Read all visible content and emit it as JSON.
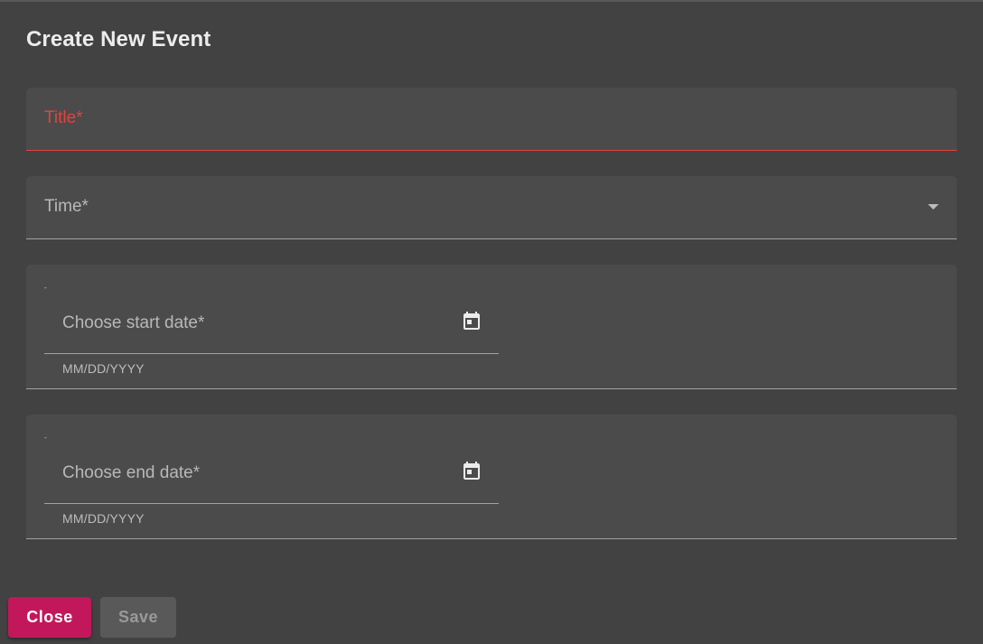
{
  "dialog": {
    "title": "Create New Event"
  },
  "fields": {
    "title": {
      "label": "Title*",
      "state": "error",
      "error_color": "#e0443d"
    },
    "time": {
      "label": "Time*",
      "icon": "chevron-down-icon"
    },
    "start_date": {
      "mark": "-",
      "label": "Choose start date*",
      "helper": "MM/DD/YYYY",
      "icon": "calendar-icon"
    },
    "end_date": {
      "mark": "-",
      "label": "Choose end date*",
      "helper": "MM/DD/YYYY",
      "icon": "calendar-icon"
    }
  },
  "actions": {
    "close_label": "Close",
    "save_label": "Save",
    "close_color": "#c2185b",
    "save_state": "disabled"
  }
}
